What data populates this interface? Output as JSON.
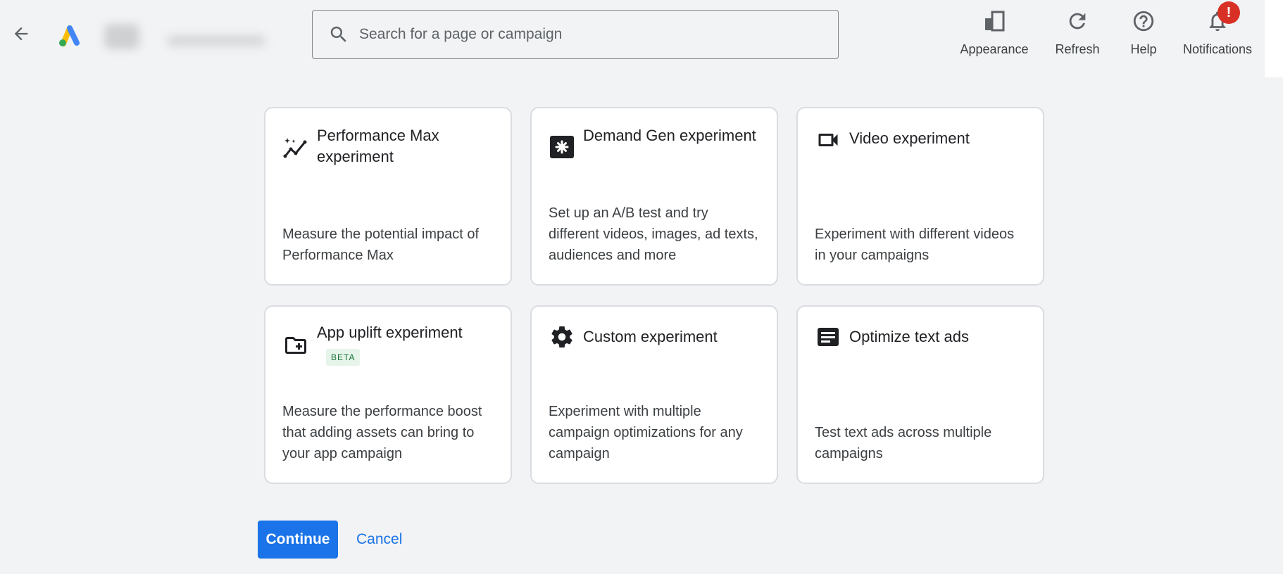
{
  "header": {
    "search_placeholder": "Search for a page or campaign",
    "actions": [
      {
        "label": "Appearance",
        "icon": "appearance-icon"
      },
      {
        "label": "Refresh",
        "icon": "refresh-icon"
      },
      {
        "label": "Help",
        "icon": "help-icon"
      },
      {
        "label": "Notifications",
        "icon": "notifications-icon"
      }
    ],
    "notification_badge": "!"
  },
  "cards": [
    {
      "title": "Performance Max experiment",
      "description": "Measure the potential impact of Performance Max",
      "icon": "sparkle-chart-icon"
    },
    {
      "title": "Demand Gen experiment",
      "description": "Set up an A/B test and try different videos, images, ad texts, audiences and more",
      "icon": "demand-gen-icon"
    },
    {
      "title": "Video experiment",
      "description": "Experiment with different videos in your campaigns",
      "icon": "video-camera-icon"
    },
    {
      "title": "App uplift experiment",
      "badge": "BETA",
      "description": "Measure the performance boost that adding assets can bring to your app campaign",
      "icon": "folder-add-icon"
    },
    {
      "title": "Custom experiment",
      "description": "Experiment with multiple campaign optimizations for any campaign",
      "icon": "gear-icon"
    },
    {
      "title": "Optimize text ads",
      "description": "Test text ads across multiple campaigns",
      "icon": "text-ad-icon"
    }
  ],
  "footer": {
    "continue_label": "Continue",
    "cancel_label": "Cancel"
  },
  "colors": {
    "background": "#f1f3f4",
    "primary": "#1a73e8",
    "alert": "#d93025",
    "beta_bg": "#e6f4ea",
    "beta_text": "#137333"
  }
}
